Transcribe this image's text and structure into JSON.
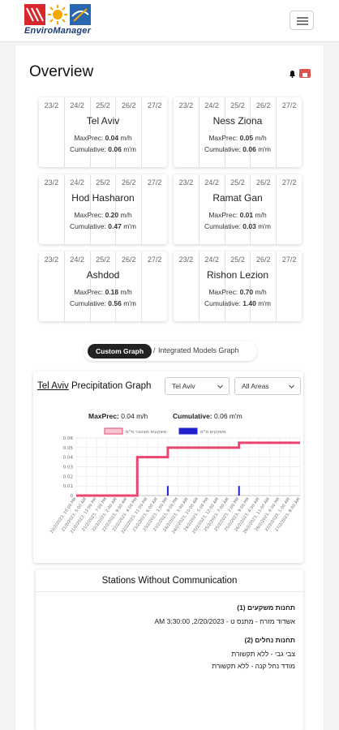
{
  "header": {
    "logo_text": "EnviroManager",
    "logo_colors": [
      "#d7262d",
      "#f2a900",
      "#2a67b0"
    ],
    "menu_icon": "hamburger-icon"
  },
  "overview": {
    "title": "Overview",
    "bell_icon": "bell-icon",
    "notification_icon": "alert-badge-icon"
  },
  "dates": [
    "23/2",
    "24/2",
    "25/2",
    "26/2",
    "27/2"
  ],
  "stat_labels": {
    "maxprec": "MaxPrec:",
    "cumulative": "Cumulative:"
  },
  "stations": [
    {
      "name": "Tel Aviv",
      "maxprec": "0.04",
      "maxprec_unit": "m/h",
      "cumulative": "0.06",
      "cumulative_unit": "m'm"
    },
    {
      "name": "Ness Ziona",
      "maxprec": "0.05",
      "maxprec_unit": "m/h",
      "cumulative": "0.06",
      "cumulative_unit": "m'm"
    },
    {
      "name": "Hod Hasharon",
      "maxprec": "0.20",
      "maxprec_unit": "m/h",
      "cumulative": "0.47",
      "cumulative_unit": "m'm"
    },
    {
      "name": "Ramat Gan",
      "maxprec": "0.01",
      "maxprec_unit": "m/h",
      "cumulative": "0.03",
      "cumulative_unit": "m'm"
    },
    {
      "name": "Ashdod",
      "maxprec": "0.18",
      "maxprec_unit": "m/h",
      "cumulative": "0.56",
      "cumulative_unit": "m'm"
    },
    {
      "name": "Rishon Lezion",
      "maxprec": "0.70",
      "maxprec_unit": "m/h",
      "cumulative": "1.40",
      "cumulative_unit": "m'm"
    }
  ],
  "graph_toggle": {
    "active": "Custom Graph",
    "separator": "/",
    "other": "Integrated Models Graph"
  },
  "graph": {
    "title_city": "Tel Aviv",
    "title_rest": "Precipitation Graph",
    "station_select": "Tel Aviv",
    "area_select": "All Areas",
    "maxprec_label": "MaxPrec:",
    "maxprec_value": "0.04 m/h",
    "cumulative_label": "Cumulative:",
    "cumulative_value": "0.06 m'm",
    "colors": {
      "cumulative": "#e8456f",
      "rate": "#2020d0"
    }
  },
  "chart_data": {
    "type": "line",
    "legend": [
      "משקעים מצטבר מ\"מ",
      "משקעים מ\"מ"
    ],
    "legend_position": "top",
    "ylim": [
      0,
      0.06
    ],
    "yticks": [
      "0",
      "0.01",
      "0.02",
      "0.03",
      "0.04",
      "0.05",
      "0.06"
    ],
    "grid": true,
    "x": [
      "20/2/2023, 10:00 PM",
      "21/2/2023, 5:00 AM",
      "21/2/2023, 12:00 PM",
      "21/2/2023, 7:00 PM",
      "22/2/2023, 2:00 AM",
      "22/2/2023, 9:00 AM",
      "22/2/2023, 4:00 PM",
      "22/2/2023, 11:00 PM",
      "23/2/2023, 6:00 AM",
      "23/2/2023, 1:00 PM",
      "23/2/2023, 8:00 PM",
      "24/2/2023, 3:00 AM",
      "24/2/2023, 10:00 AM",
      "24/2/2023, 5:00 PM",
      "25/2/2023, 12:00 AM",
      "25/2/2023, 7:00 AM",
      "25/2/2023, 2:00 PM",
      "25/2/2023, 9:00 PM",
      "26/2/2023, 4:00 AM",
      "26/2/2023, 11:00 AM",
      "26/2/2023, 6:00 PM",
      "27/2/2023, 1:00 AM",
      "27/2/2023, 8:00 AM"
    ],
    "series": [
      {
        "name": "משקעים מצטבר מ\"מ",
        "type": "line",
        "values": [
          0,
          0,
          0,
          0,
          0,
          0,
          0.04,
          0.04,
          0.04,
          0.05,
          0.05,
          0.05,
          0.05,
          0.05,
          0.05,
          0.05,
          0.055,
          0.055,
          0.055,
          0.055,
          0.055,
          0.055,
          0.055
        ]
      },
      {
        "name": "משקעים מ\"מ",
        "type": "bar",
        "values": [
          0,
          0,
          0,
          0,
          0,
          0,
          0.04,
          0,
          0,
          0.01,
          0,
          0,
          0,
          0,
          0,
          0,
          0.01,
          0,
          0,
          0,
          0,
          0,
          0
        ]
      }
    ]
  },
  "no_communication": {
    "title": "Stations Without Communication",
    "rain_header": "תחנות משקעים (1)",
    "rain_items": [
      "אשדוד מזרח - מתנס ט - 2/20/2023, 3:30:00 AM"
    ],
    "stream_header": "תחנות נחלים (2)",
    "stream_items": [
      "צבי גבי - ללא תקשורת",
      "מודד נחל קנה - ללא תקשורת"
    ]
  }
}
